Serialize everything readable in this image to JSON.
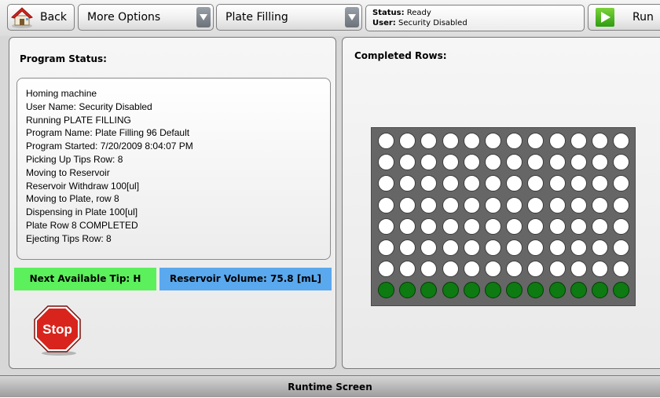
{
  "toolbar": {
    "back_label": "Back",
    "more_options_label": "More Options",
    "program_select_value": "Plate Filling",
    "status_label": "Status:",
    "status_value": "Ready",
    "user_label": "User:",
    "user_value": "Security Disabled",
    "run_label": "Run",
    "icons": {
      "back": "house-icon",
      "dropdown": "chevron-down-icon",
      "run": "play-icon"
    }
  },
  "left_panel": {
    "title": "Program Status:",
    "log_lines": [
      "Homing machine",
      "User Name: Security Disabled",
      "Running PLATE FILLING",
      "Program Name: Plate Filling 96 Default",
      "Program Started: 7/20/2009 8:04:07 PM",
      "Picking Up Tips Row: 8",
      "Moving to Reservoir",
      "Reservoir Withdraw 100[ul]",
      "Moving to Plate, row 8",
      "Dispensing in Plate 100[ul]",
      "Plate Row 8 COMPLETED",
      "Ejecting Tips Row: 8"
    ],
    "next_tip": "Next Available Tip: H",
    "reservoir_volume": "Reservoir Volume: 75.8 [mL]",
    "stop_label": "Stop",
    "colors": {
      "next_tip_bg": "#5cf05c",
      "reservoir_bg": "#5aa8ee",
      "stop_red": "#d8241c"
    }
  },
  "right_panel": {
    "title": "Completed Rows:",
    "plate": {
      "rows": 8,
      "columns": 12,
      "completed_rows": [
        8
      ],
      "colors": {
        "empty": "#ffffff",
        "filled": "#0d7a12",
        "plate": "#666666"
      }
    }
  },
  "footer": {
    "label": "Runtime Screen"
  }
}
